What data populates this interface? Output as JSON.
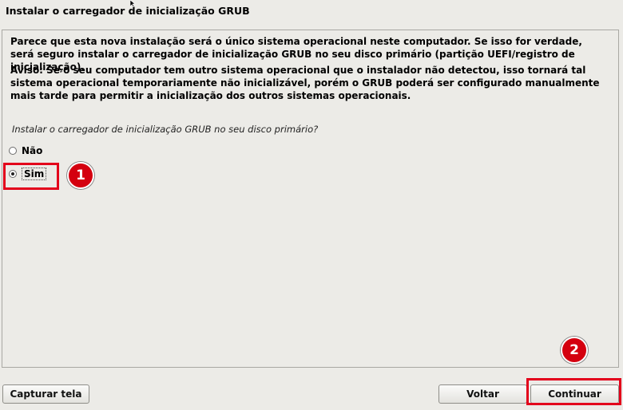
{
  "window": {
    "title": "Instalar o carregador de inicialização GRUB"
  },
  "content": {
    "paragraph1": "Parece que esta nova instalação será o único sistema operacional neste computador. Se isso for verdade, será seguro instalar o carregador de inicialização GRUB no seu disco primário (partição UEFI/registro de inicialização).",
    "paragraph2": "Aviso: Se o seu computador tem outro sistema operacional que o instalador não detectou, isso tornará tal sistema operacional temporariamente não inicializável, porém o GRUB poderá ser configurado manualmente mais tarde para permitir a inicialização dos outros sistemas operacionais.",
    "question": "Instalar o carregador de inicialização GRUB no seu disco primário?",
    "options": [
      {
        "label": "Não",
        "selected": false
      },
      {
        "label": "Sim",
        "selected": true
      }
    ]
  },
  "annotations": {
    "step1": "1",
    "step2": "2",
    "highlight_color": "#e3001b"
  },
  "buttons": {
    "capture": "Capturar tela",
    "back": "Voltar",
    "continue": "Continuar"
  }
}
